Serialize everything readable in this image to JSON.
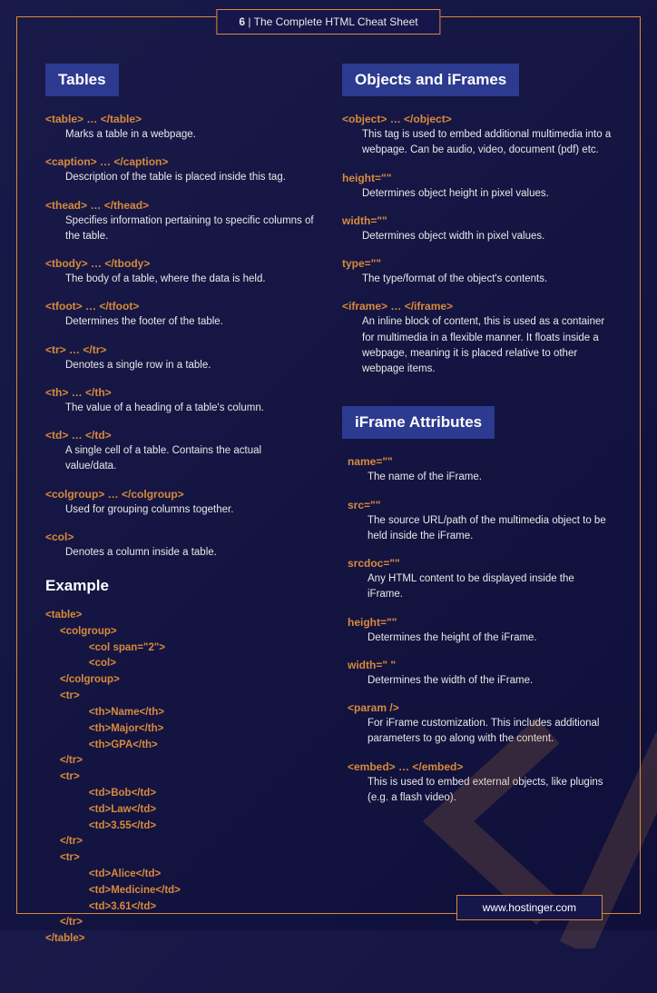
{
  "header": {
    "page_number": "6",
    "title": "The Complete HTML Cheat Sheet"
  },
  "footer": {
    "url": "www.hostinger.com"
  },
  "left": {
    "section_title": "Tables",
    "entries": [
      {
        "tag": "<table> … </table>",
        "desc": "Marks a table in a webpage."
      },
      {
        "tag": "<caption> … </caption>",
        "desc": "Description of the table is placed inside this tag."
      },
      {
        "tag": "<thead> … </thead>",
        "desc": "Specifies information pertaining to specific columns of the table."
      },
      {
        "tag": "<tbody> … </tbody>",
        "desc": "The body of a table, where the data is held."
      },
      {
        "tag": "<tfoot> … </tfoot>",
        "desc": "Determines the footer of the table."
      },
      {
        "tag": "<tr> … </tr>",
        "desc": "Denotes a single row in a table."
      },
      {
        "tag": "<th> … </th>",
        "desc": "The value of a heading of a table's column."
      },
      {
        "tag": "<td> … </td>",
        "desc": "A single cell of a table. Contains the actual value/data."
      },
      {
        "tag": "<colgroup> … </colgroup>",
        "desc": "Used for grouping columns together."
      },
      {
        "tag": "<col>",
        "desc": "Denotes a column inside a table."
      }
    ],
    "example_title": "Example",
    "code_lines": [
      "<table>",
      "     <colgroup>",
      "               <col span=\"2\">",
      "               <col>",
      "     </colgroup>",
      "     <tr>",
      "               <th>Name</th>",
      "               <th>Major</th>",
      "               <th>GPA</th>",
      "     </tr>",
      "     <tr>",
      "               <td>Bob</td>",
      "               <td>Law</td>",
      "               <td>3.55</td>",
      "     </tr>",
      "     <tr>",
      "               <td>Alice</td>",
      "               <td>Medicine</td>",
      "               <td>3.61</td>",
      "     </tr>",
      "</table>"
    ]
  },
  "right": {
    "section1_title": "Objects and iFrames",
    "entries1": [
      {
        "tag": "<object> … </object>",
        "desc": "This tag is used to embed additional multimedia into a webpage. Can be audio, video, document (pdf) etc."
      },
      {
        "tag": "height=\"\"",
        "desc": "Determines object height in pixel values."
      },
      {
        "tag": "width=\"\"",
        "desc": "Determines object width in pixel values."
      },
      {
        "tag": "type=\"\"",
        "desc": "The type/format of the object's contents."
      },
      {
        "tag": "<iframe> … </iframe>",
        "desc": "An inline block of content, this is used as a container for multimedia in a flexible manner. It floats inside a webpage, meaning it is placed relative to other webpage items."
      }
    ],
    "section2_title": "iFrame Attributes",
    "entries2": [
      {
        "tag": "name=\"\"",
        "desc": "The name of the iFrame."
      },
      {
        "tag": "src=\"\"",
        "desc": "The source URL/path of the multimedia object to be held inside the iFrame."
      },
      {
        "tag": "srcdoc=\"\"",
        "desc": "Any HTML content to be displayed inside the iFrame."
      },
      {
        "tag": "height=\"\"",
        "desc": "Determines the height of the iFrame."
      },
      {
        "tag": "width=\" \"",
        "desc": "Determines the width of the iFrame."
      },
      {
        "tag": "<param />",
        "desc": "For iFrame customization. This includes additional parameters to go along with the content."
      },
      {
        "tag": "<embed> … </embed>",
        "desc": "This is used to embed external objects, like plugins (e.g. a flash video)."
      }
    ]
  }
}
